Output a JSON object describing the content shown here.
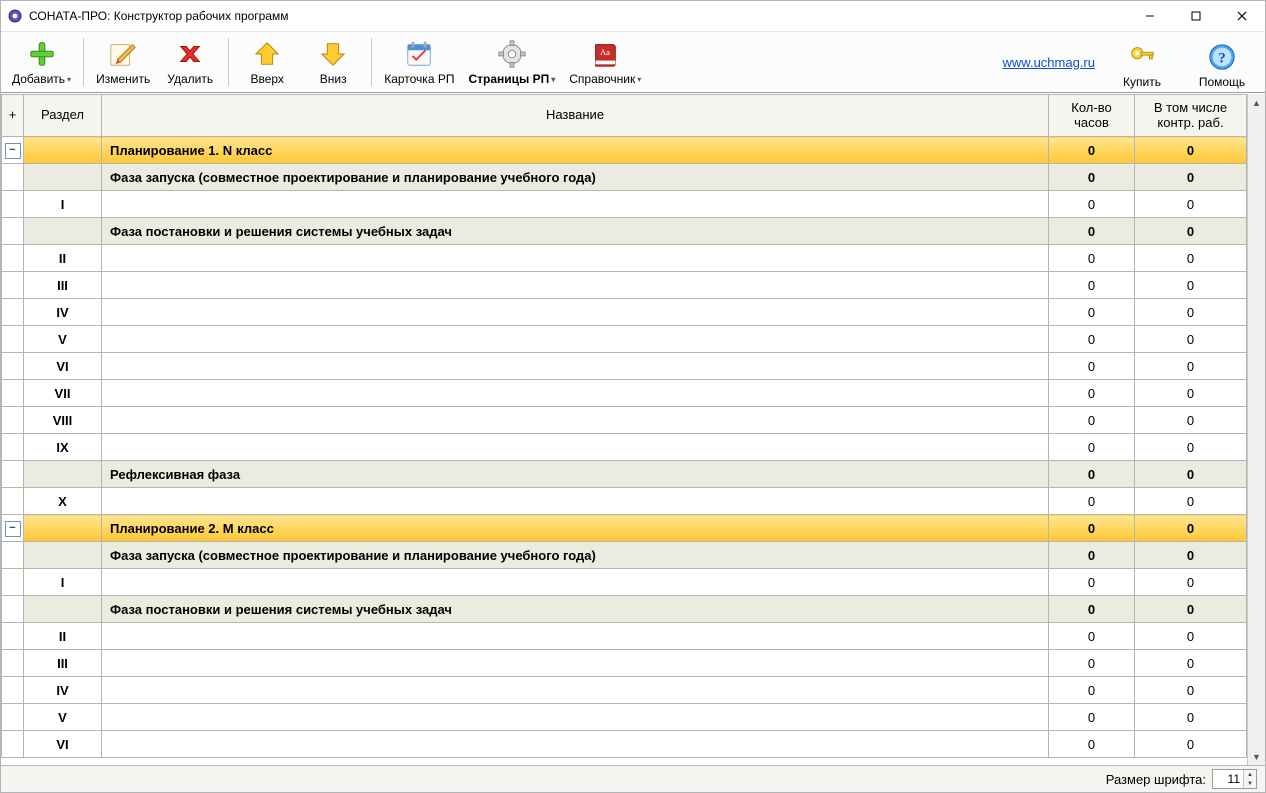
{
  "window": {
    "title": "СОНАТА-ПРО: Конструктор рабочих программ"
  },
  "toolbar": {
    "add": "Добавить",
    "edit": "Изменить",
    "delete": "Удалить",
    "up": "Вверх",
    "down": "Вниз",
    "card": "Карточка РП",
    "pages": "Страницы РП",
    "handbook": "Справочник",
    "buy": "Купить",
    "help": "Помощь",
    "link_text": "www.uchmag.ru"
  },
  "grid": {
    "headers": {
      "expand": "+",
      "section": "Раздел",
      "name": "Название",
      "hours": "Кол-во часов",
      "kontr": "В том числе контр. раб."
    },
    "rows": [
      {
        "type": "plan",
        "expand": "-",
        "section": "",
        "name": "Планирование 1. N класс",
        "hours": "0",
        "kontr": "0"
      },
      {
        "type": "phase",
        "expand": "",
        "section": "",
        "name": "Фаза запуска (совместное проектирование и  планирование учебного года)",
        "hours": "0",
        "kontr": "0"
      },
      {
        "type": "item",
        "expand": "",
        "section": "I",
        "name": "",
        "hours": "0",
        "kontr": "0"
      },
      {
        "type": "phase",
        "expand": "",
        "section": "",
        "name": "Фаза постановки и решения системы учебных задач",
        "hours": "0",
        "kontr": "0"
      },
      {
        "type": "item",
        "expand": "",
        "section": "II",
        "name": "",
        "hours": "0",
        "kontr": "0"
      },
      {
        "type": "item",
        "expand": "",
        "section": "III",
        "name": "",
        "hours": "0",
        "kontr": "0"
      },
      {
        "type": "item",
        "expand": "",
        "section": "IV",
        "name": "",
        "hours": "0",
        "kontr": "0"
      },
      {
        "type": "item",
        "expand": "",
        "section": "V",
        "name": "",
        "hours": "0",
        "kontr": "0"
      },
      {
        "type": "item",
        "expand": "",
        "section": "VI",
        "name": "",
        "hours": "0",
        "kontr": "0"
      },
      {
        "type": "item",
        "expand": "",
        "section": "VII",
        "name": "",
        "hours": "0",
        "kontr": "0"
      },
      {
        "type": "item",
        "expand": "",
        "section": "VIII",
        "name": "",
        "hours": "0",
        "kontr": "0"
      },
      {
        "type": "item",
        "expand": "",
        "section": "IX",
        "name": "",
        "hours": "0",
        "kontr": "0"
      },
      {
        "type": "phase",
        "expand": "",
        "section": "",
        "name": "Рефлексивная фаза",
        "hours": "0",
        "kontr": "0"
      },
      {
        "type": "item",
        "expand": "",
        "section": "X",
        "name": "",
        "hours": "0",
        "kontr": "0"
      },
      {
        "type": "plan",
        "expand": "-",
        "section": "",
        "name": "Планирование 2. M класс",
        "hours": "0",
        "kontr": "0"
      },
      {
        "type": "phase",
        "expand": "",
        "section": "",
        "name": "Фаза запуска (совместное проектирование и  планирование учебного года)",
        "hours": "0",
        "kontr": "0"
      },
      {
        "type": "item",
        "expand": "",
        "section": "I",
        "name": "",
        "hours": "0",
        "kontr": "0"
      },
      {
        "type": "phase",
        "expand": "",
        "section": "",
        "name": "Фаза постановки и решения системы учебных задач",
        "hours": "0",
        "kontr": "0"
      },
      {
        "type": "item",
        "expand": "",
        "section": "II",
        "name": "",
        "hours": "0",
        "kontr": "0"
      },
      {
        "type": "item",
        "expand": "",
        "section": "III",
        "name": "",
        "hours": "0",
        "kontr": "0"
      },
      {
        "type": "item",
        "expand": "",
        "section": "IV",
        "name": "",
        "hours": "0",
        "kontr": "0"
      },
      {
        "type": "item",
        "expand": "",
        "section": "V",
        "name": "",
        "hours": "0",
        "kontr": "0"
      },
      {
        "type": "item",
        "expand": "",
        "section": "VI",
        "name": "",
        "hours": "0",
        "kontr": "0"
      }
    ]
  },
  "statusbar": {
    "font_label": "Размер шрифта:",
    "font_size": "11"
  }
}
